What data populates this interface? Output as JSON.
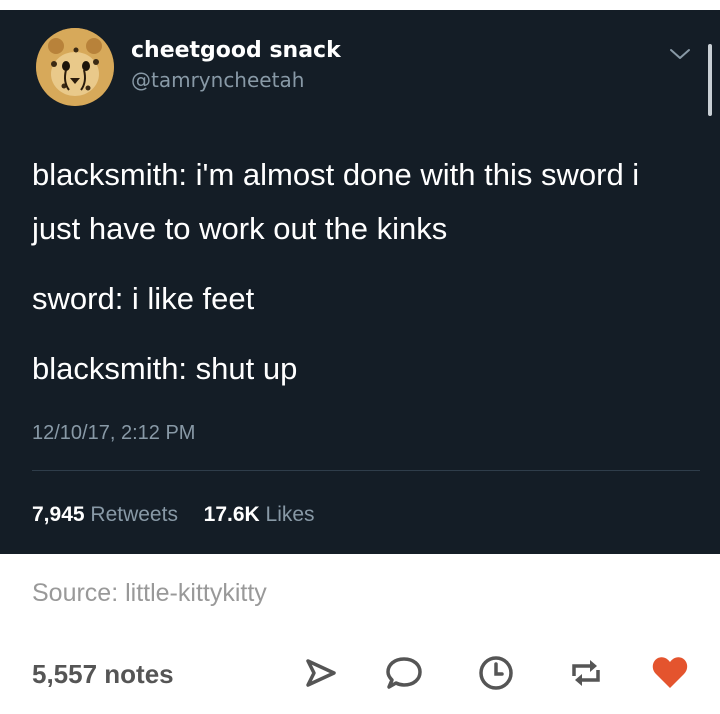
{
  "tweet": {
    "display_name": "cheetgood snack",
    "handle": "@tamryncheetah",
    "lines": [
      "blacksmith: i'm almost done with this sword i just have to work out the kinks",
      "sword: i like feet",
      "blacksmith: shut up"
    ],
    "timestamp": "12/10/17, 2:12 PM",
    "retweets_count": "7,945",
    "retweets_label": "Retweets",
    "likes_count": "17.6K",
    "likes_label": "Likes"
  },
  "post": {
    "source": "Source: little-kittykitty",
    "notes": "5,557 notes"
  },
  "icons": {
    "avatar": "cheetah-avatar",
    "menu": "chevron-down-icon",
    "share": "share-icon",
    "reply": "reply-icon",
    "history": "history-icon",
    "reblog": "reblog-icon",
    "like": "heart-icon"
  },
  "colors": {
    "tweet_background": "#141d26",
    "secondary_text": "#8899a6",
    "icon_gray": "#555555",
    "like_red": "#e4542e"
  }
}
